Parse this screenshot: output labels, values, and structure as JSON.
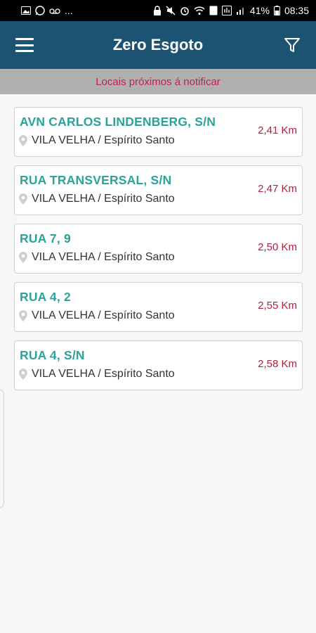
{
  "status_bar": {
    "battery": "41%",
    "time": "08:35",
    "more": "..."
  },
  "app_bar": {
    "title": "Zero Esgoto",
    "icons": {
      "left": "menu-icon",
      "right": "filter-icon"
    }
  },
  "notice": {
    "text": "Locais próximos á notificar"
  },
  "locations": [
    {
      "street": "AVN CARLOS LINDENBERG, S/N",
      "city": "VILA VELHA / Espírito Santo",
      "distance": "2,41 Km"
    },
    {
      "street": "RUA TRANSVERSAL, S/N",
      "city": "VILA VELHA / Espírito Santo",
      "distance": "2,47 Km"
    },
    {
      "street": "RUA 7, 9",
      "city": "VILA VELHA / Espírito Santo",
      "distance": "2,50 Km"
    },
    {
      "street": "RUA 4, 2",
      "city": "VILA VELHA / Espírito Santo",
      "distance": "2,55 Km"
    },
    {
      "street": "RUA 4, S/N",
      "city": "VILA VELHA / Espírito Santo",
      "distance": "2,58 Km"
    }
  ],
  "colors": {
    "app_bar": "#1c5372",
    "notice_bar": "#b0b0b0",
    "notice_text": "#c0214f",
    "street_text": "#2aa39a",
    "distance_text": "#b0203c"
  }
}
